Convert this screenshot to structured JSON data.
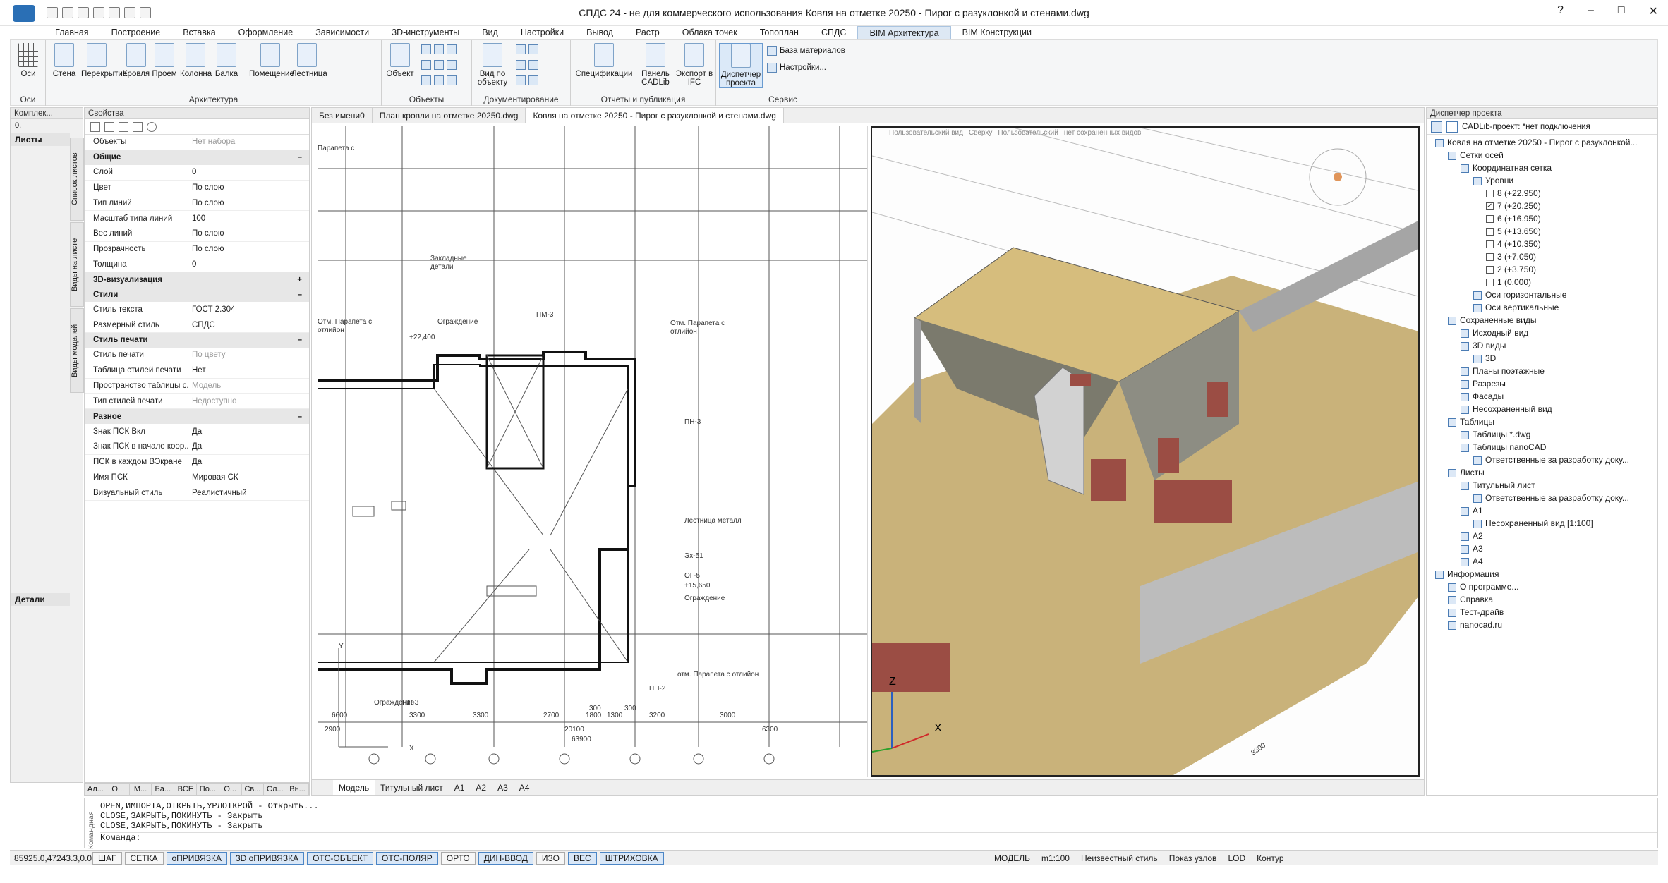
{
  "titlebar": {
    "title": "СПДС 24 - не для коммерческого использования Ковля на отметке 20250 - Пирог с разуклонкой и стенами.dwg",
    "help": "?",
    "minimize": "–",
    "maximize": "□",
    "close": "✕"
  },
  "menu": [
    "Главная",
    "Построение",
    "Вставка",
    "Оформление",
    "Зависимости",
    "3D-инструменты",
    "Вид",
    "Настройки",
    "Вывод",
    "Растр",
    "Облака точек",
    "Топоплан",
    "СПДС",
    "BIM Архитектура",
    "BIM Конструкции"
  ],
  "ribbon": {
    "groups": [
      "Оси",
      "Архитектура",
      "Объекты",
      "Документирование",
      "Отчеты и публикация",
      "Сервис"
    ],
    "axes_btn": "Оси",
    "arch_buttons": [
      "Стена",
      "Перекрытие",
      "Кровля",
      "Проем",
      "Колонна",
      "Балка",
      "Помещение",
      "Лестница"
    ],
    "object_btn": "Объект",
    "doc_btn": "Вид по объекту",
    "report_buttons": [
      "Спецификации",
      "Панель CADLib",
      "Экспорт в IFC"
    ],
    "service_btn": "Диспетчер проекта",
    "service_small": [
      "База материалов",
      "Настройки..."
    ]
  },
  "left_panel": {
    "title": "Комплек...",
    "combo": "0.",
    "sheets_label": "Листы",
    "details_label": "Детали",
    "vtabs": [
      "Список листов",
      "Виды на листе",
      "Виды моделей"
    ]
  },
  "props": {
    "title": "Свойства",
    "objects": {
      "k": "Объекты",
      "v": "Нет набора"
    },
    "sections": [
      {
        "name": "Общие",
        "sign": "–",
        "rows": [
          [
            "Слой",
            "0"
          ],
          [
            "Цвет",
            "По слою"
          ],
          [
            "Тип линий",
            "По слою"
          ],
          [
            "Масштаб типа линий",
            "100"
          ],
          [
            "Вес линий",
            "По слою"
          ],
          [
            "Прозрачность",
            "По слою"
          ],
          [
            "Толщина",
            "0"
          ]
        ]
      },
      {
        "name": "3D-визуализация",
        "sign": "+",
        "rows": []
      },
      {
        "name": "Стили",
        "sign": "–",
        "rows": [
          [
            "Стиль текста",
            "ГОСТ 2.304"
          ],
          [
            "Размерный стиль",
            "СПДС"
          ]
        ]
      },
      {
        "name": "Стиль печати",
        "sign": "–",
        "rows": [
          [
            "Стиль печати",
            "По цвету"
          ],
          [
            "Таблица стилей печати",
            "Нет"
          ],
          [
            "Пространство таблицы с...",
            "Модель"
          ],
          [
            "Тип стилей печати",
            "Недоступно"
          ]
        ]
      },
      {
        "name": "Разное",
        "sign": "–",
        "rows": [
          [
            "Знак ПСК Вкл",
            "Да"
          ],
          [
            "Знак ПСК в начале коор...",
            "Да"
          ],
          [
            "ПСК в каждом ВЭкране",
            "Да"
          ],
          [
            "Имя ПСК",
            "Мировая СК"
          ],
          [
            "Визуальный стиль",
            "Реалистичный"
          ]
        ]
      }
    ],
    "bottom_tabs": [
      "Ал...",
      "О...",
      "М...",
      "Ба...",
      "BCF",
      "По...",
      "О...",
      "Св...",
      "Сл...",
      "Вн..."
    ]
  },
  "doc_tabs": [
    "Без имени0",
    "План кровли на отметке 20250.dwg",
    "Ковля на отметке 20250 - Пирог с разуклонкой и стенами.dwg"
  ],
  "model_tabs": [
    "Модель",
    "Титульный лист",
    "A1",
    "A2",
    "A3",
    "A4"
  ],
  "plan": {
    "labels": [
      "Парапета с",
      "Отм. Парапета с",
      "отлийон",
      "Ограждение",
      "Закладные",
      "детали",
      "ПМ-3",
      "+22,400",
      "Отм. Парапета с",
      "отлийон",
      "ПН-3",
      "Лестница металл",
      "Эх-51",
      "ОГ-5",
      "+15,650",
      "Ограждение",
      "отм. Парапета с отлийон",
      "ПН-2",
      "ПН-3",
      "Ограждение",
      "Y",
      "X"
    ],
    "dims": [
      "6600",
      "3300",
      "3300",
      "2700",
      "1800",
      "1300",
      "3200",
      "3000",
      "300",
      "300",
      "20100",
      "6300",
      "63900",
      "2900"
    ]
  },
  "view3d": {
    "header": [
      "Пользовательский вид",
      "Сверху",
      "Пользовательский",
      "нет сохраненных видов"
    ],
    "axis_z": "Z",
    "axis_x": "X",
    "grid_label": "3300"
  },
  "right_panel": {
    "title": "Диспетчер проекта",
    "cadlib": "CADLib-проект: *нет подключения",
    "tree": [
      {
        "d": 0,
        "t": "Ковля на отметке 20250 - Пирог с разуклонкой..."
      },
      {
        "d": 1,
        "t": "Сетки осей"
      },
      {
        "d": 2,
        "t": "Координатная сетка"
      },
      {
        "d": 3,
        "t": "Уровни"
      },
      {
        "d": 4,
        "t": "8 (+22.950)",
        "cb": ""
      },
      {
        "d": 4,
        "t": "7 (+20.250)",
        "cb": "✓"
      },
      {
        "d": 4,
        "t": "6 (+16.950)",
        "cb": ""
      },
      {
        "d": 4,
        "t": "5 (+13.650)",
        "cb": ""
      },
      {
        "d": 4,
        "t": "4 (+10.350)",
        "cb": ""
      },
      {
        "d": 4,
        "t": "3 (+7.050)",
        "cb": ""
      },
      {
        "d": 4,
        "t": "2 (+3.750)",
        "cb": ""
      },
      {
        "d": 4,
        "t": "1 (0.000)",
        "cb": ""
      },
      {
        "d": 3,
        "t": "Оси горизонтальные"
      },
      {
        "d": 3,
        "t": "Оси вертикальные"
      },
      {
        "d": 1,
        "t": "Сохраненные виды"
      },
      {
        "d": 2,
        "t": "Исходный вид"
      },
      {
        "d": 2,
        "t": "3D виды"
      },
      {
        "d": 3,
        "t": "3D"
      },
      {
        "d": 2,
        "t": "Планы поэтажные"
      },
      {
        "d": 2,
        "t": "Разрезы"
      },
      {
        "d": 2,
        "t": "Фасады"
      },
      {
        "d": 2,
        "t": "Несохраненный вид"
      },
      {
        "d": 1,
        "t": "Таблицы"
      },
      {
        "d": 2,
        "t": "Таблицы *.dwg"
      },
      {
        "d": 2,
        "t": "Таблицы nanoCAD"
      },
      {
        "d": 3,
        "t": "Ответственные за разработку доку..."
      },
      {
        "d": 1,
        "t": "Листы"
      },
      {
        "d": 2,
        "t": "Титульный лист"
      },
      {
        "d": 3,
        "t": "Ответственные за разработку доку..."
      },
      {
        "d": 2,
        "t": "A1"
      },
      {
        "d": 3,
        "t": "Несохраненный вид [1:100]"
      },
      {
        "d": 2,
        "t": "A2"
      },
      {
        "d": 2,
        "t": "A3"
      },
      {
        "d": 2,
        "t": "A4"
      },
      {
        "d": 0,
        "t": "Информация"
      },
      {
        "d": 1,
        "t": "О программе..."
      },
      {
        "d": 1,
        "t": "Справка"
      },
      {
        "d": 1,
        "t": "Тест-драйв"
      },
      {
        "d": 1,
        "t": "nanocad.ru"
      }
    ]
  },
  "command": {
    "lines": [
      "OPEN,ИМПОРТА,ОТКРЫТЬ,УРЛОТКРОЙ - Открыть...",
      "CLOSE,ЗАКРЫТЬ,ПОКИНУТЬ - Закрыть",
      "CLOSE,ЗАКРЫТЬ,ПОКИНУТЬ - Закрыть"
    ],
    "prompt": "Команда:",
    "side": "Командная"
  },
  "status": {
    "coord": "85925.0,47243.3,0.0",
    "toggles": [
      {
        "l": "ШАГ",
        "on": false
      },
      {
        "l": "СЕТКА",
        "on": false
      },
      {
        "l": "оПРИВЯЗКА",
        "on": true
      },
      {
        "l": "3D оПРИВЯЗКА",
        "on": true
      },
      {
        "l": "ОТС-ОБЪЕКТ",
        "on": true
      },
      {
        "l": "ОТС-ПОЛЯР",
        "on": true
      },
      {
        "l": "ОРТО",
        "on": false
      },
      {
        "l": "ДИН-ВВОД",
        "on": true
      },
      {
        "l": "ИЗО",
        "on": false
      },
      {
        "l": "ВЕС",
        "on": true
      },
      {
        "l": "ШТРИХОВКА",
        "on": true
      }
    ],
    "mode": "МОДЕЛЬ",
    "scale": "m1:100",
    "style": "Неизвестный стиль",
    "nodes": "Показ узлов",
    "lod": "LOD",
    "contour": "Контур"
  }
}
